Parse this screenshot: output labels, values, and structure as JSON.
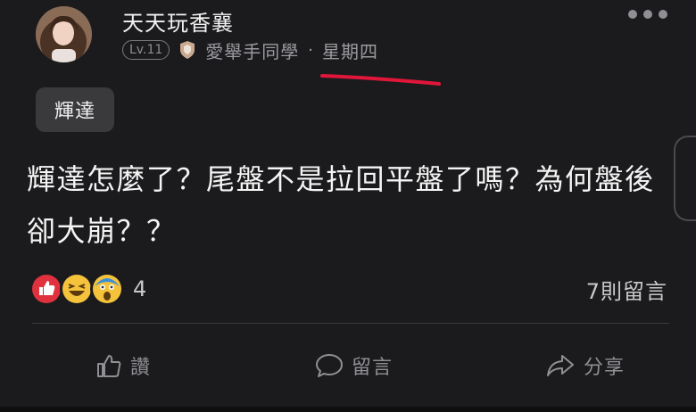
{
  "post": {
    "author": "天天玩香襄",
    "level": "Lv.11",
    "group": "愛舉手同學",
    "separator": "·",
    "day": "星期四",
    "tag": "輝達",
    "body": "輝達怎麼了？尾盤不是拉回平盤了嗎？為何盤後卻大崩？？",
    "reaction_count": "4",
    "comment_count": "7則留言"
  },
  "reactions": [
    "thumbs-up-icon",
    "laughing-emoji-icon",
    "shocked-emoji-icon"
  ],
  "actions": {
    "like_label": "讚",
    "comment_label": "留言",
    "share_label": "分享"
  },
  "colors": {
    "background": "#1b1b1d",
    "highlight_underline": "#e0163a",
    "muted_text": "#9a9aa0"
  }
}
